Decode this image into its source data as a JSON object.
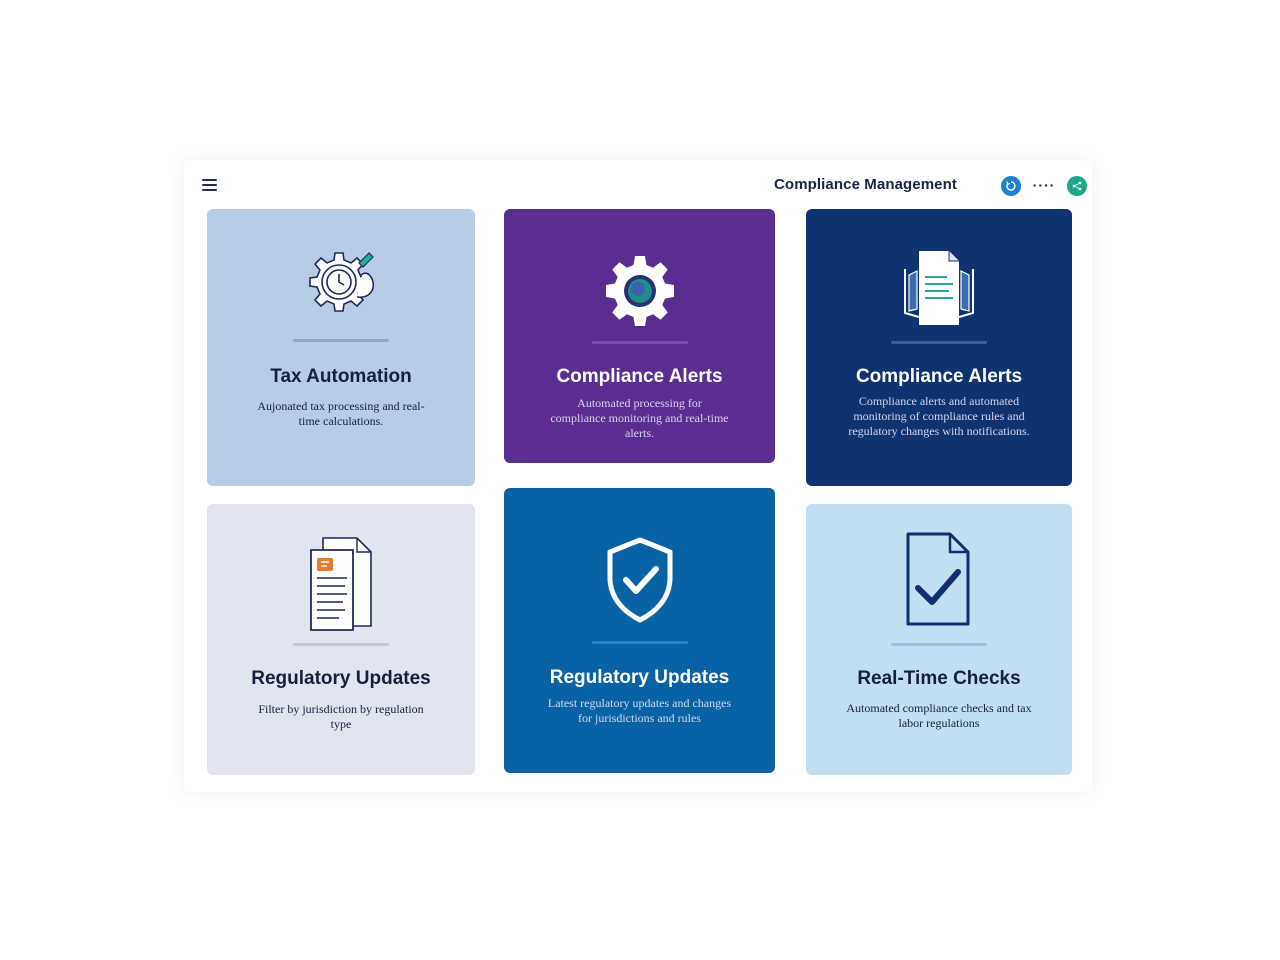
{
  "header": {
    "title": "Compliance Management",
    "menu_icon": "hamburger-menu-icon",
    "actions": [
      {
        "icon": "sync-icon",
        "color": "#1f7fd1"
      },
      {
        "icon": "more-icon",
        "label": "····"
      },
      {
        "icon": "share-icon",
        "color": "#1aa88a"
      }
    ]
  },
  "cards": [
    {
      "title": "Tax Automation",
      "description": "Aujonated tax processing and real-time calculations.",
      "icon": "gear-clock-icon",
      "background": "#b8cce6"
    },
    {
      "title": "Compliance Alerts",
      "description": "Automated processing for compliance monitoring and real-time alerts.",
      "icon": "gear-icon",
      "background": "#5a2d91"
    },
    {
      "title": "Compliance Alerts",
      "description": "Compliance alerts and automated monitoring of compliance rules and regulatory changes with notifications.",
      "icon": "document-icon",
      "background": "#0d3470"
    },
    {
      "title": "Regulatory Updates",
      "description": "Filter by jurisdiction by regulation type",
      "icon": "regulation-document-icon",
      "background": "#e1e5f0"
    },
    {
      "title": "Regulatory Updates",
      "description": "Latest regulatory updates and changes for jurisdictions and rules",
      "icon": "shield-check-icon",
      "background": "#0962a3"
    },
    {
      "title": "Real-Time Checks",
      "description": "Automated compliance checks and tax labor regulations",
      "icon": "document-check-icon",
      "background": "#c2def1"
    }
  ]
}
